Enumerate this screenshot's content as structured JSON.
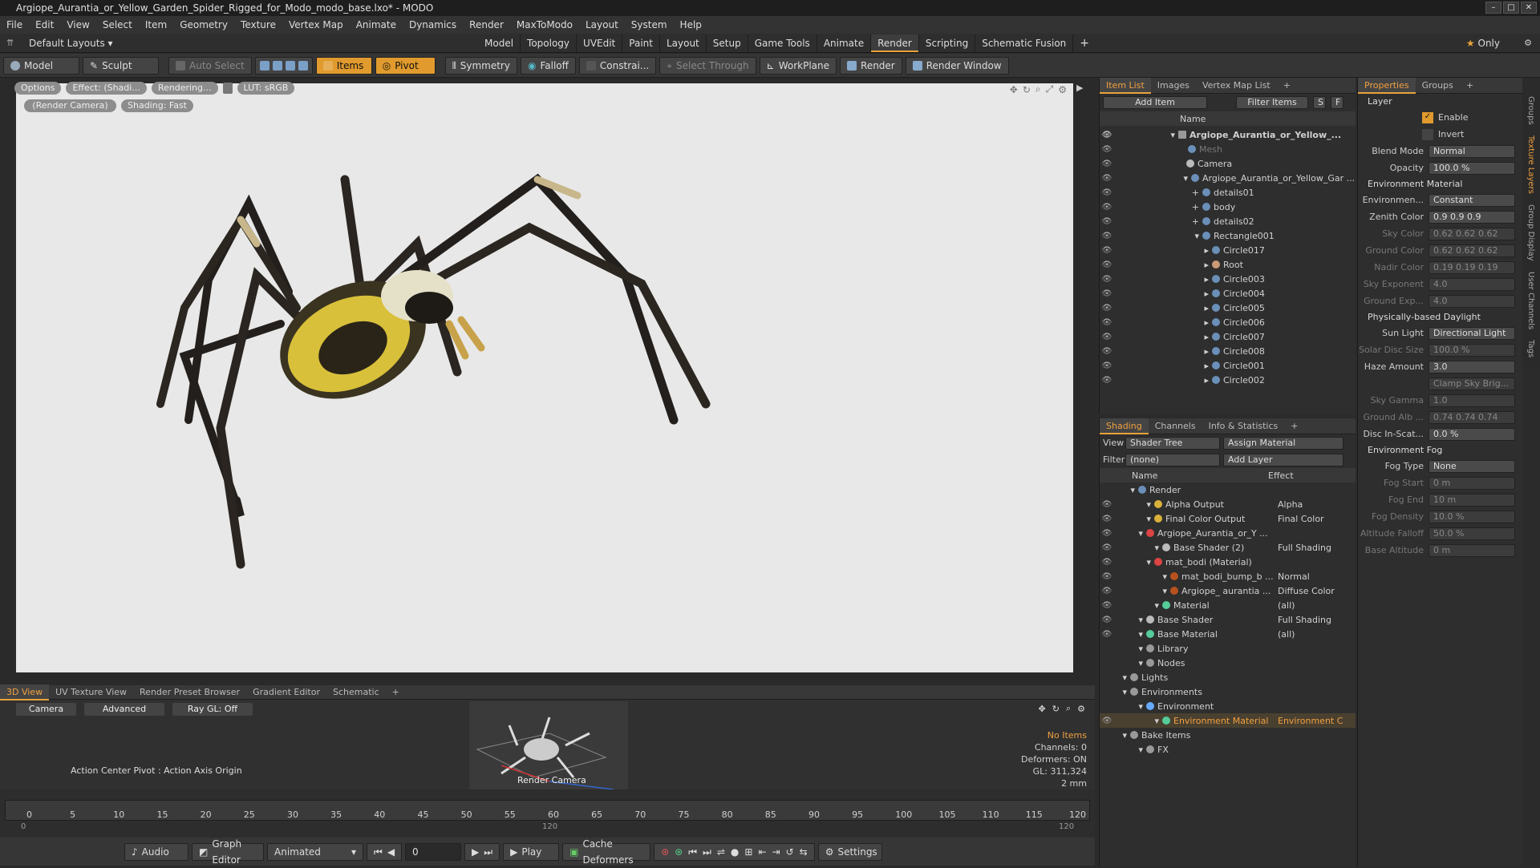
{
  "window": {
    "title": "Argiope_Aurantia_or_Yellow_Garden_Spider_Rigged_for_Modo_modo_base.lxo* - MODO"
  },
  "menu": [
    "File",
    "Edit",
    "View",
    "Select",
    "Item",
    "Geometry",
    "Texture",
    "Vertex Map",
    "Animate",
    "Dynamics",
    "Render",
    "MaxToModo",
    "Layout",
    "System",
    "Help"
  ],
  "layouts": {
    "preset": "Default Layouts ▾",
    "tabs": [
      "Model",
      "Topology",
      "UVEdit",
      "Paint",
      "Layout",
      "Setup",
      "Game Tools",
      "Animate",
      "Render",
      "Scripting",
      "Schematic Fusion"
    ],
    "active": "Render",
    "only": "Only"
  },
  "toolbar": {
    "model": "Model",
    "sculpt": "Sculpt",
    "auto_select": "Auto Select",
    "items": "Items",
    "pivot": "Pivot",
    "symmetry": "Symmetry",
    "falloff": "Falloff",
    "constrain": "Constrai...",
    "select_through": "Select Through",
    "workplane": "WorkPlane",
    "render": "Render",
    "render_window": "Render Window"
  },
  "viewport": {
    "options": "Options",
    "effect": "Effect: (Shadi...",
    "rendering": "Rendering...",
    "lut": "LUT: sRGB",
    "camera": "(Render Camera)",
    "shading": "Shading: Fast"
  },
  "bottom": {
    "tabs": [
      "3D View",
      "UV Texture View",
      "Render Preset Browser",
      "Gradient Editor",
      "Schematic"
    ],
    "camera": "Camera",
    "advanced": "Advanced",
    "raygl": "Ray GL: Off",
    "action_center": "Action Center Pivot : Action Axis Origin",
    "render_camera": "Render Camera",
    "stats": [
      "No Items",
      "Channels: 0",
      "Deformers: ON",
      "GL: 311,324",
      "2 mm"
    ]
  },
  "timeline": {
    "ticks": [
      "0",
      "5",
      "10",
      "15",
      "20",
      "25",
      "30",
      "35",
      "40",
      "45",
      "50",
      "55",
      "60",
      "65",
      "70",
      "75",
      "80",
      "85",
      "90",
      "95",
      "100",
      "105",
      "110",
      "115",
      "120"
    ],
    "sub": [
      "0",
      "120",
      "120"
    ]
  },
  "transport": {
    "audio": "Audio",
    "graph_editor": "Graph Editor",
    "animated": "Animated",
    "frame": "0",
    "play": "Play",
    "cache": "Cache Deformers",
    "settings": "Settings"
  },
  "itemlist": {
    "tabs": [
      "Item List",
      "Images",
      "Vertex Map List"
    ],
    "add_item": "Add Item",
    "filter": "Filter Items",
    "col_name": "Name",
    "rows": [
      "Argiope_Aurantia_or_Yellow_...",
      "Mesh",
      "Camera",
      "Argiope_Aurantia_or_Yellow_Gar ...",
      "details01",
      "body",
      "details02",
      "Rectangle001",
      "Circle017",
      "Root",
      "Circle003",
      "Circle004",
      "Circle005",
      "Circle006",
      "Circle007",
      "Circle008",
      "Circle001",
      "Circle002"
    ]
  },
  "shading": {
    "tabs": [
      "Shading",
      "Channels",
      "Info & Statistics"
    ],
    "view_label": "View",
    "view": "Shader Tree",
    "assign": "Assign Material",
    "filter_label": "Filter",
    "filter": "(none)",
    "add_layer": "Add Layer",
    "col_name": "Name",
    "col_effect": "Effect",
    "rows": [
      {
        "name": "Render",
        "effect": ""
      },
      {
        "name": "Alpha Output",
        "effect": "Alpha"
      },
      {
        "name": "Final Color Output",
        "effect": "Final Color"
      },
      {
        "name": "Argiope_Aurantia_or_Y ...",
        "effect": ""
      },
      {
        "name": "Base Shader (2)",
        "effect": "Full Shading"
      },
      {
        "name": "mat_bodi (Material)",
        "effect": ""
      },
      {
        "name": "mat_bodi_bump_b ...",
        "effect": "Normal"
      },
      {
        "name": "Argiope_ aurantia ...",
        "effect": "Diffuse Color"
      },
      {
        "name": "Material",
        "effect": "(all)"
      },
      {
        "name": "Base Shader",
        "effect": "Full Shading"
      },
      {
        "name": "Base Material",
        "effect": "(all)"
      },
      {
        "name": "Library",
        "effect": ""
      },
      {
        "name": "Nodes",
        "effect": ""
      },
      {
        "name": "Lights",
        "effect": ""
      },
      {
        "name": "Environments",
        "effect": ""
      },
      {
        "name": "Environment",
        "effect": ""
      },
      {
        "name": "Environment Material",
        "effect": "Environment Co..."
      },
      {
        "name": "Bake Items",
        "effect": ""
      },
      {
        "name": "FX",
        "effect": ""
      }
    ]
  },
  "properties": {
    "tabs": [
      "Properties",
      "Groups"
    ],
    "side_tabs": [
      "Groups",
      "Texture Layers",
      "Group Display",
      "User Channels",
      "Tags"
    ],
    "layer": "Layer",
    "enable": "Enable",
    "invert": "Invert",
    "rows": [
      {
        "label": "Blend Mode",
        "value": "Normal",
        "dim": false
      },
      {
        "label": "Opacity",
        "value": "100.0 %",
        "dim": false
      },
      {
        "section": "Environment Material"
      },
      {
        "label": "Environmen...",
        "value": "Constant",
        "dim": false
      },
      {
        "label": "Zenith Color",
        "value": "0.9   0.9   0.9",
        "dim": false
      },
      {
        "label": "Sky Color",
        "value": "0.62  0.62  0.62",
        "dim": true
      },
      {
        "label": "Ground Color",
        "value": "0.62  0.62  0.62",
        "dim": true
      },
      {
        "label": "Nadir Color",
        "value": "0.19  0.19  0.19",
        "dim": true
      },
      {
        "label": "Sky Exponent",
        "value": "4.0",
        "dim": true
      },
      {
        "label": "Ground Exp...",
        "value": "4.0",
        "dim": true
      },
      {
        "section": "Physically-based Daylight"
      },
      {
        "label": "Sun Light",
        "value": "Directional Light",
        "dim": false
      },
      {
        "label": "Solar Disc Size",
        "value": "100.0 %",
        "dim": true
      },
      {
        "label": "Haze Amount",
        "value": "3.0",
        "dim": false
      },
      {
        "label": "",
        "value": "Clamp Sky Brig...",
        "dim": true
      },
      {
        "label": "Sky Gamma",
        "value": "1.0",
        "dim": true
      },
      {
        "label": "Ground Alb ...",
        "value": "0.74  0.74  0.74",
        "dim": true
      },
      {
        "label": "Disc In-Scat...",
        "value": "0.0 %",
        "dim": false
      },
      {
        "section": "Environment Fog"
      },
      {
        "label": "Fog Type",
        "value": "None",
        "dim": false
      },
      {
        "label": "Fog Start",
        "value": "0 m",
        "dim": true
      },
      {
        "label": "Fog End",
        "value": "10 m",
        "dim": true
      },
      {
        "label": "Fog Density",
        "value": "10.0 %",
        "dim": true
      },
      {
        "label": "Altitude Falloff",
        "value": "50.0 %",
        "dim": true
      },
      {
        "label": "Base Altitude",
        "value": "0 m",
        "dim": true
      }
    ]
  }
}
